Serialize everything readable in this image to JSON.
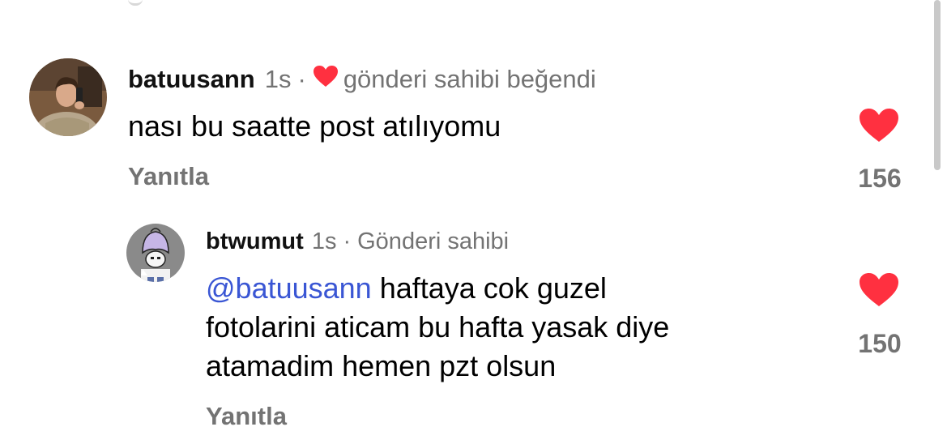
{
  "comments": [
    {
      "username": "batuusann",
      "time": "1s",
      "separator": "·",
      "liked_label": "gönderi sahibi beğendi",
      "text": "nası bu saatte post atılıyomu",
      "reply_label": "Yanıtla",
      "like_count": "156",
      "avatar_icon": "user-photo-avatar"
    },
    {
      "username": "btwumut",
      "time": "1s",
      "separator": "·",
      "owner_label": "Gönderi sahibi",
      "mention": "@batuusann",
      "text_line1": "haftaya cok guzel",
      "text_line2": "fotolarini aticam bu hafta yasak diye",
      "text_line3": "atamadim hemen pzt olsun",
      "reply_label": "Yanıtla",
      "like_count": "150",
      "avatar_icon": "cartoon-character-avatar"
    }
  ],
  "colors": {
    "heart": "#ff3040",
    "mention": "#3a56d4",
    "muted": "#737373"
  }
}
